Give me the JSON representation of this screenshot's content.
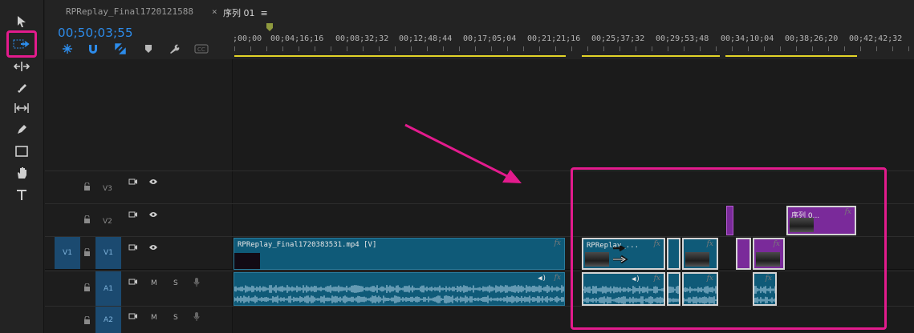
{
  "tabs": {
    "project": "RPReplay_Final1720121588",
    "close_glyph": "×",
    "sequence": "序列 01",
    "menu_glyph": "≡"
  },
  "timecode": "00;50;03;55",
  "ruler": {
    "ticks": [
      {
        "label": ";00;00",
        "time": "00;00;00;00"
      },
      {
        "label": "00;04;16;16",
        "time": "00;04;16;16"
      },
      {
        "label": "00;08;32;32",
        "time": "00;08;32;32"
      },
      {
        "label": "00;12;48;44",
        "time": "00;12;48;44"
      },
      {
        "label": "00;17;05;04",
        "time": "00;17;05;04"
      },
      {
        "label": "00;21;21;16",
        "time": "00;21;21;16"
      },
      {
        "label": "00;25;37;32",
        "time": "00;25;37;32"
      },
      {
        "label": "00;29;53;48",
        "time": "00;29;53;48"
      },
      {
        "label": "00;34;10;04",
        "time": "00;34;10;04"
      },
      {
        "label": "00;38;26;20",
        "time": "00;38;26;20"
      },
      {
        "label": "00;42;42;32",
        "time": "00;42;42;32"
      }
    ]
  },
  "tracks": {
    "v3": {
      "label": "V3"
    },
    "v2": {
      "label": "V2"
    },
    "v1": {
      "label": "V1",
      "source_label": "V1"
    },
    "a1": {
      "label": "A1",
      "mute": "M",
      "solo": "S"
    },
    "a2": {
      "label": "A2",
      "mute": "M",
      "solo": "S"
    }
  },
  "clips": {
    "main_video": "RPReplay_Final1720383531.mp4 [V]",
    "rp_short": "RPReplay_...",
    "nested_seq": "序列 0...",
    "fx": "fx"
  },
  "colors": {
    "accent_blue": "#2d8ceb",
    "annotation": "#e31b8d",
    "video_clip": "#0f5a78",
    "nested_clip": "#7a2a9a",
    "work_area": "#e3d428"
  }
}
